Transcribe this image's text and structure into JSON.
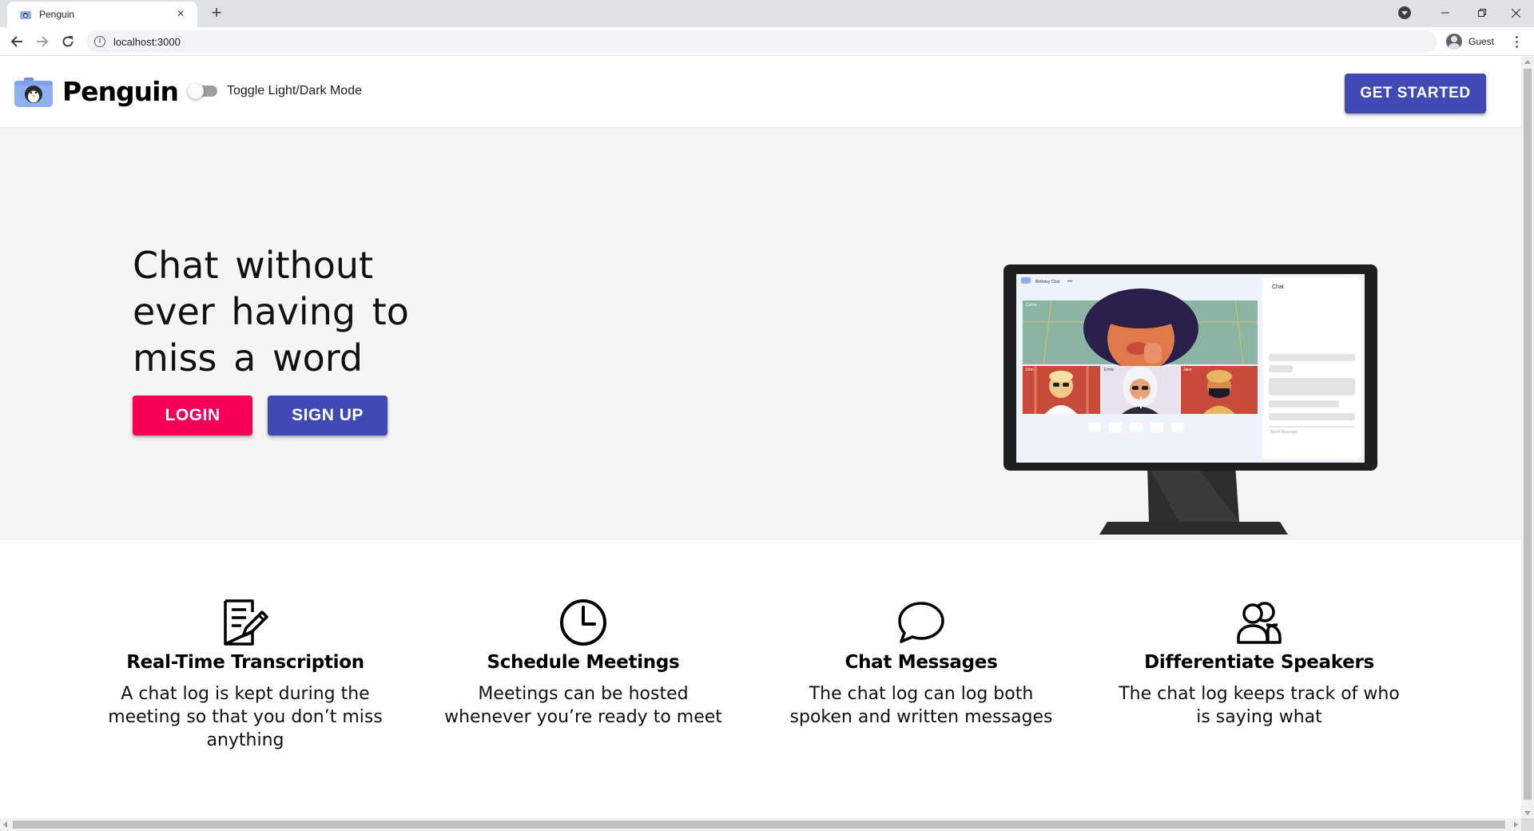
{
  "browser": {
    "tab_title": "Penguin",
    "url": "localhost:3000",
    "profile_label": "Guest"
  },
  "header": {
    "brand": "Penguin",
    "toggle_label": "Toggle Light/Dark Mode",
    "toggle_on": false,
    "cta_label": "GET STARTED"
  },
  "hero": {
    "title": "Chat without ever having to miss a word",
    "login_label": "LOGIN",
    "signup_label": "SIGN UP",
    "illustration": {
      "meeting_title": "Birthday Chat",
      "chat_panel_title": "Chat",
      "participants": [
        "Carrie",
        "John",
        "Emily",
        "Jake"
      ],
      "send_placeholder": "Send Message"
    }
  },
  "features": [
    {
      "icon": "note-pencil-icon",
      "title": "Real-Time Transcription",
      "desc": "A chat log is kept during the meeting so that you don’t miss anything"
    },
    {
      "icon": "clock-icon",
      "title": "Schedule Meetings",
      "desc": "Meetings can be hosted whenever you’re ready to meet"
    },
    {
      "icon": "chat-bubble-icon",
      "title": "Chat Messages",
      "desc": "The chat log can log both spoken and written messages"
    },
    {
      "icon": "people-icon",
      "title": "Differentiate Speakers",
      "desc": "The chat log keeps track of who is saying what"
    }
  ],
  "colors": {
    "primary": "#3f4ab5",
    "secondary": "#f50057",
    "hero_bg": "#f5f5f5"
  }
}
